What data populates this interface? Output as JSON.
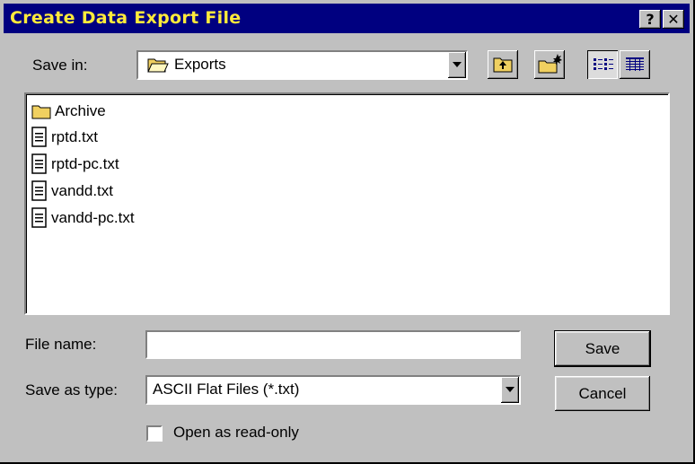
{
  "dialog": {
    "title": "Create Data Export File",
    "help_button": "?",
    "close_button": "✕"
  },
  "save_in": {
    "label": "Save in:",
    "value": "Exports"
  },
  "toolbar": {
    "icons": [
      "up-one-level-icon",
      "create-new-folder-icon",
      "list-view-icon",
      "details-view-icon"
    ]
  },
  "files": [
    {
      "name": "Archive",
      "type": "folder"
    },
    {
      "name": "rptd.txt",
      "type": "text-file"
    },
    {
      "name": "rptd-pc.txt",
      "type": "text-file"
    },
    {
      "name": "vandd.txt",
      "type": "text-file"
    },
    {
      "name": "vandd-pc.txt",
      "type": "text-file"
    }
  ],
  "file_name": {
    "label": "File name:",
    "value": ""
  },
  "save_as_type": {
    "label": "Save as type:",
    "value": "ASCII Flat Files (*.txt)"
  },
  "read_only": {
    "label": "Open as read-only",
    "checked": false
  },
  "buttons": {
    "save": "Save",
    "cancel": "Cancel"
  }
}
